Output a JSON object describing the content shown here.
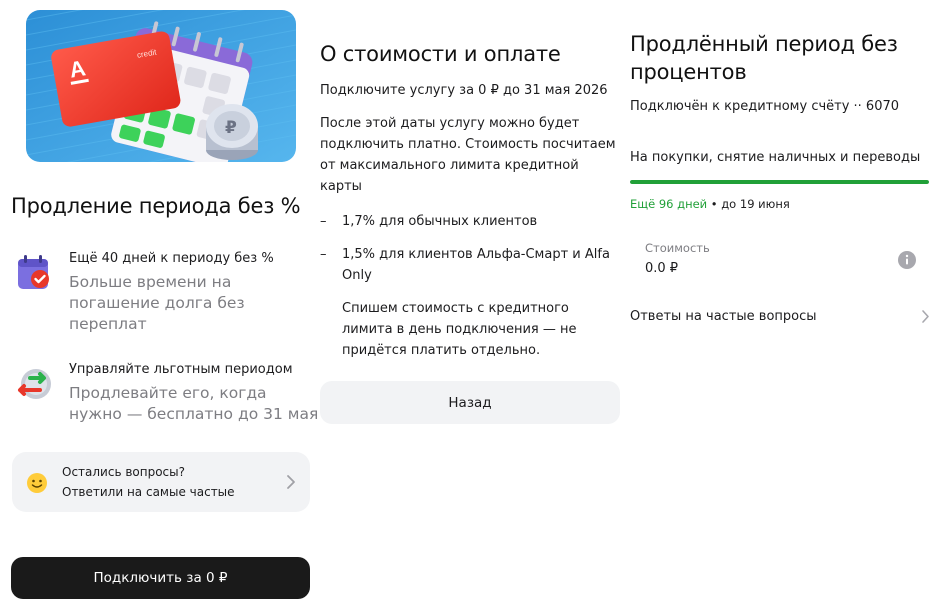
{
  "service_intro": {
    "title": "Продление периода без %",
    "features": [
      {
        "icon": "calendar-check-icon",
        "heading": "Ещё 40 дней к периоду без %",
        "subtitle": "Больше времени на погашение долга без переплат"
      },
      {
        "icon": "swap-arrows-icon",
        "heading": "Управляйте льготным периодом",
        "subtitle": "Продлевайте его, когда нужно — бесплатно до 31 мая"
      }
    ],
    "faq_card": {
      "icon": "smile-emoji-icon",
      "line1": "Остались вопросы?",
      "line2": "Ответили на самые частые"
    },
    "connect_button": "Подключить за 0 ₽",
    "hero": {
      "card_logo": "А",
      "card_text": "credit",
      "coin_symbol": "₽"
    }
  },
  "cost_info": {
    "title": "О стоимости и оплате",
    "free_until": "Подключите услугу за 0 ₽ до 31 мая 2026",
    "paragraph": "После этой даты услугу можно будет подключить платно. Стоимость посчитаем от максимального лимита кредитной карты",
    "bullets": [
      {
        "dash": "–",
        "text": "1,7% для обычных клиентов"
      },
      {
        "dash": "–",
        "text": "1,5% для клиентов Альфа-Смарт и Alfa Only"
      }
    ],
    "note": "Спишем стоимость с кредитного лимита в день подключения — не придётся платить отдельно.",
    "back_button": "Назад"
  },
  "active_service": {
    "title": "Продлённый период без процентов",
    "account": "Подключён к кредитному счёту ·· 6070",
    "scope": "На покупки, снятие наличных и переводы",
    "progress_fraction": 1.0,
    "remaining_highlight": "Ещё 96 дней",
    "remaining_rest": " • до 19 июня",
    "cost_label": "Стоимость",
    "cost_value": "0.0 ₽",
    "faq_link": "Ответы на частые вопросы"
  },
  "colors": {
    "accent_green": "#21a038",
    "alfa_red": "#ef3124",
    "button_dark": "#1a1a1a",
    "card_bg": "#f2f3f5",
    "muted_text": "#7d7d82"
  }
}
